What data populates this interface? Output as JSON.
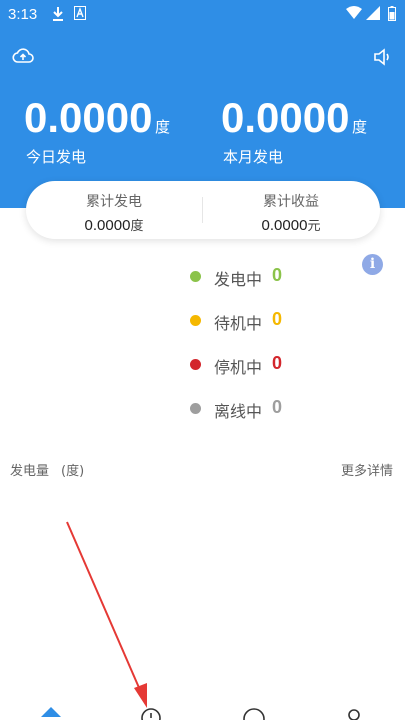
{
  "status_bar": {
    "time": "3:13",
    "icons": [
      "download-icon",
      "a-icon",
      "wifi-icon",
      "signal-icon",
      "battery-icon"
    ]
  },
  "header": {
    "today_value": "0.0000",
    "today_unit": "度",
    "today_label": "今日发电",
    "month_value": "0.0000",
    "month_unit": "度",
    "month_label": "本月发电",
    "bg_color": "#2f8ee6"
  },
  "summary": {
    "total_gen_title": "累计发电",
    "total_gen_value": "0.0000",
    "total_gen_unit": "度",
    "total_income_title": "累计收益",
    "total_income_value": "0.0000",
    "total_income_unit": "元"
  },
  "statuses": [
    {
      "label": "发电中",
      "count": "0",
      "color": "#8bc34a"
    },
    {
      "label": "待机中",
      "count": "0",
      "color": "#f5b800"
    },
    {
      "label": "停机中",
      "count": "0",
      "color": "#d3262c"
    },
    {
      "label": "离线中",
      "count": "0",
      "color": "#9e9e9e"
    }
  ],
  "chart": {
    "title": "发电量",
    "unit": "(度)",
    "more": "更多详情"
  },
  "nav": [
    "home-icon",
    "stats-icon",
    "device-icon",
    "profile-icon"
  ],
  "annotation_color": "#e53935"
}
